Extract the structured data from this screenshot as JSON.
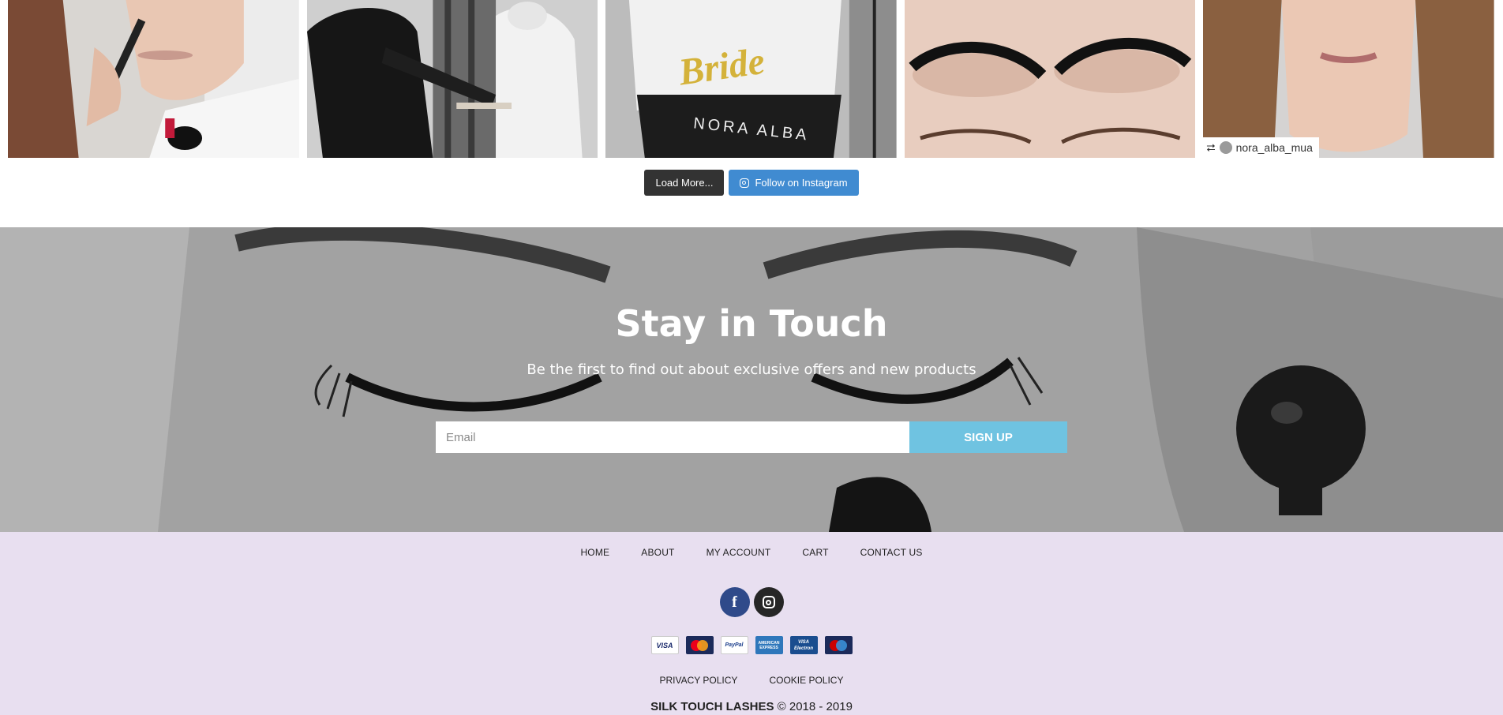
{
  "instagram": {
    "tiles": [
      {
        "alt": "makeup application"
      },
      {
        "alt": "makeup artist at work"
      },
      {
        "alt": "bride robe on chair"
      },
      {
        "alt": "eyelash extensions"
      },
      {
        "alt": "woman portrait"
      }
    ],
    "repost_username": "nora_alba_mua",
    "chair_text": "NORA ALBA",
    "robe_text": "Bride",
    "load_more_label": "Load More...",
    "follow_label": "Follow on Instagram"
  },
  "newsletter": {
    "title": "Stay in Touch",
    "subtitle": "Be the first to find out about exclusive offers and new products",
    "email_placeholder": "Email",
    "signup_label": "SIGN UP"
  },
  "footer": {
    "nav": [
      {
        "label": "HOME"
      },
      {
        "label": "ABOUT"
      },
      {
        "label": "MY ACCOUNT"
      },
      {
        "label": "CART"
      },
      {
        "label": "CONTACT US"
      }
    ],
    "social": {
      "facebook_glyph": "f"
    },
    "payments": {
      "visa": "VISA",
      "paypal": "PayPal",
      "amex": "AMERICAN EXPRESS",
      "electron_top": "VISA",
      "electron_bottom": "Electron"
    },
    "legal": [
      {
        "label": "PRIVACY POLICY"
      },
      {
        "label": "COOKIE POLICY"
      }
    ],
    "brand": "SILK TOUCH LASHES",
    "copyright": "© 2018 - 2019"
  },
  "colors": {
    "load_more_bg": "#333333",
    "follow_bg": "#408bd1",
    "signup_bg": "#6fc3e1",
    "footer_bg": "#e8dff0",
    "facebook": "#2f4a8a",
    "instagram": "#262626"
  }
}
